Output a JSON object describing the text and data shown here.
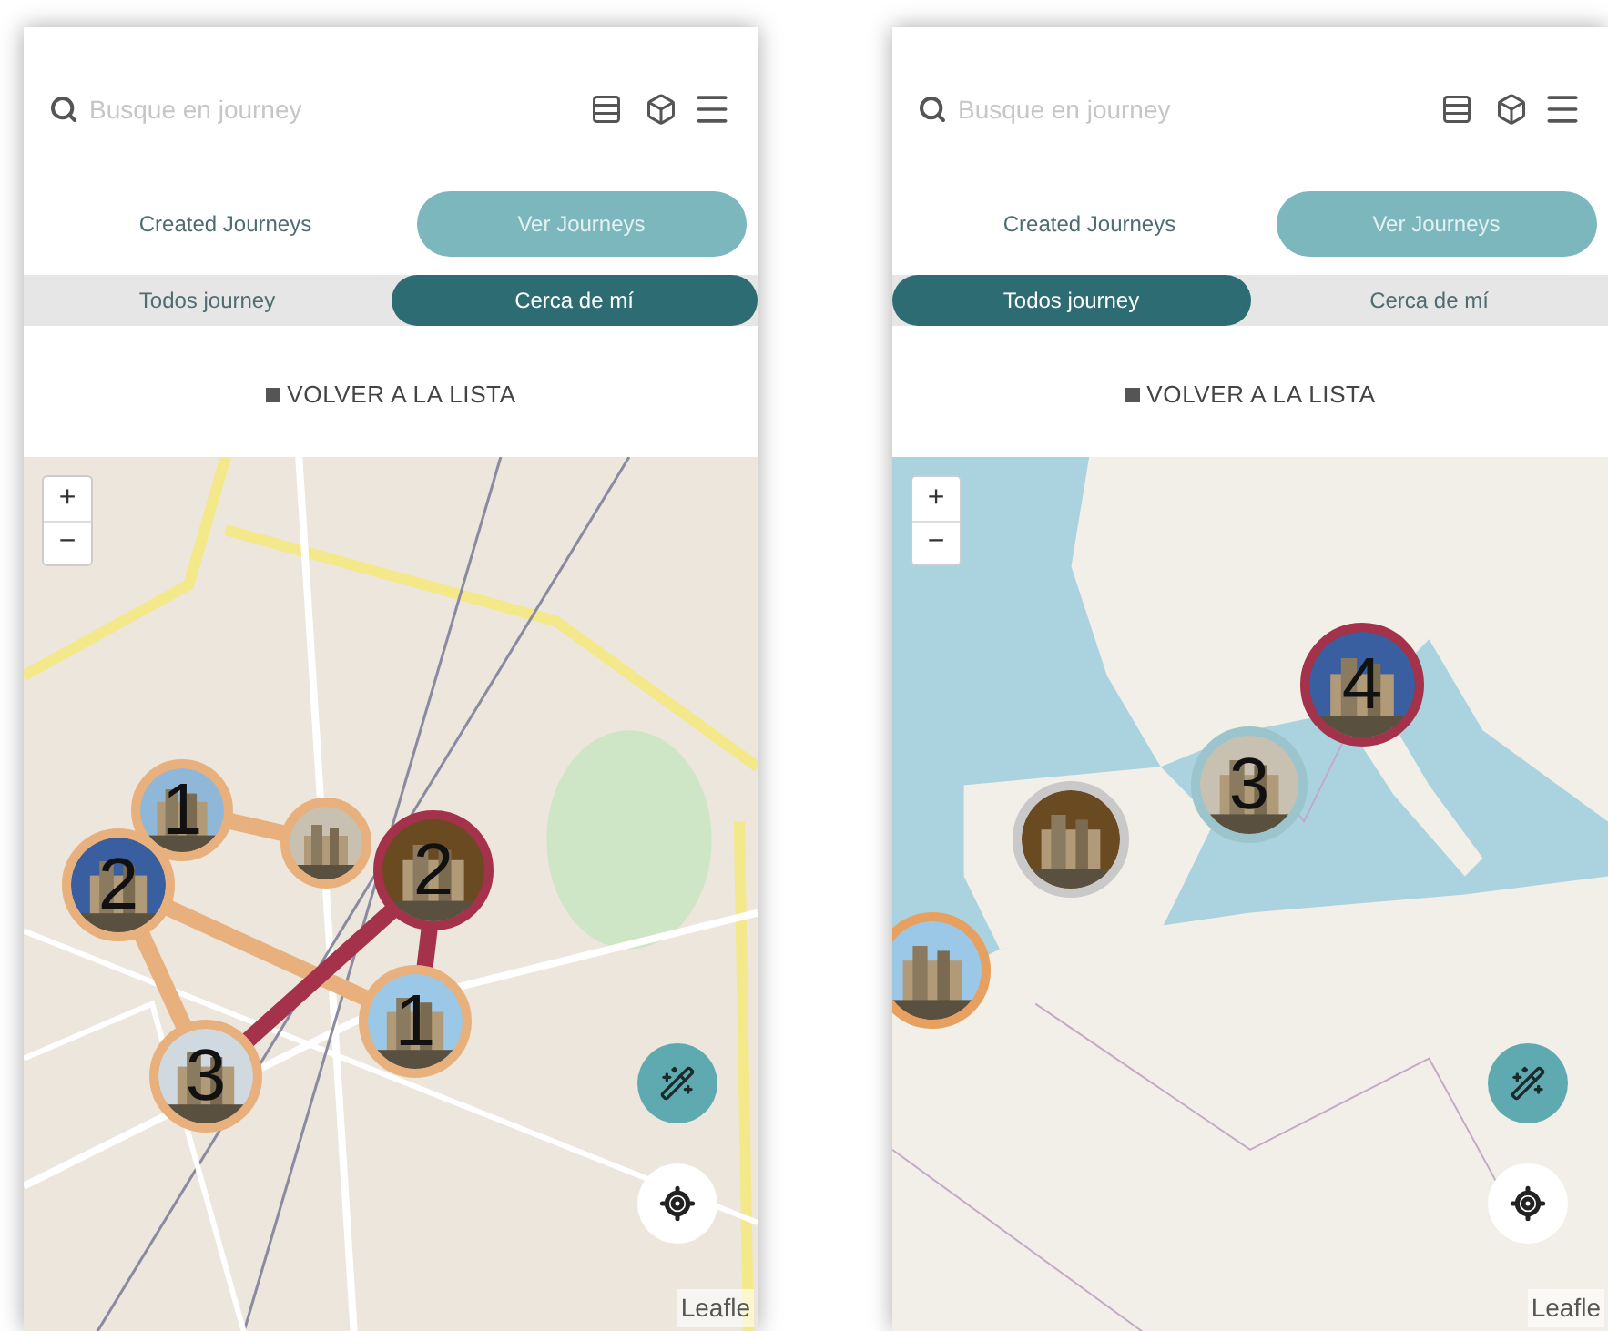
{
  "screens": [
    {
      "search": {
        "placeholder": "Busque en journey"
      },
      "tabs": [
        {
          "label": "Created Journeys",
          "selected": false
        },
        {
          "label": "Ver Journeys",
          "selected": true
        }
      ],
      "filters": [
        {
          "label": "Todos journey",
          "selected": false
        },
        {
          "label": "Cerca de mí",
          "selected": true
        }
      ],
      "back_link": "VOLVER A LA LISTA",
      "map": {
        "kind": "city",
        "zoom_in": "+",
        "zoom_out": "−",
        "attribution": "Leafle",
        "markers": [
          {
            "number": "1",
            "color": "#e8b07c"
          },
          {
            "number": "2",
            "color": "#e8b07c"
          },
          {
            "color": "#e8b07c"
          },
          {
            "number": "2",
            "color": "#a3324a"
          },
          {
            "number": "1",
            "color": "#e8b07c"
          },
          {
            "number": "3",
            "color": "#e8b07c"
          }
        ]
      }
    },
    {
      "search": {
        "placeholder": "Busque en journey"
      },
      "tabs": [
        {
          "label": "Created Journeys",
          "selected": false
        },
        {
          "label": "Ver Journeys",
          "selected": true
        }
      ],
      "filters": [
        {
          "label": "Todos journey",
          "selected": true
        },
        {
          "label": "Cerca de mí",
          "selected": false
        }
      ],
      "back_link": "VOLVER A LA LISTA",
      "map": {
        "kind": "continent",
        "zoom_in": "+",
        "zoom_out": "−",
        "attribution": "Leafle",
        "markers": [
          {
            "number": "4",
            "color": "#a3324a"
          },
          {
            "number": "3",
            "color": "#9cc4cc"
          },
          {
            "color": "#c9c9c9"
          },
          {
            "color": "#e8a060"
          }
        ]
      }
    }
  ]
}
